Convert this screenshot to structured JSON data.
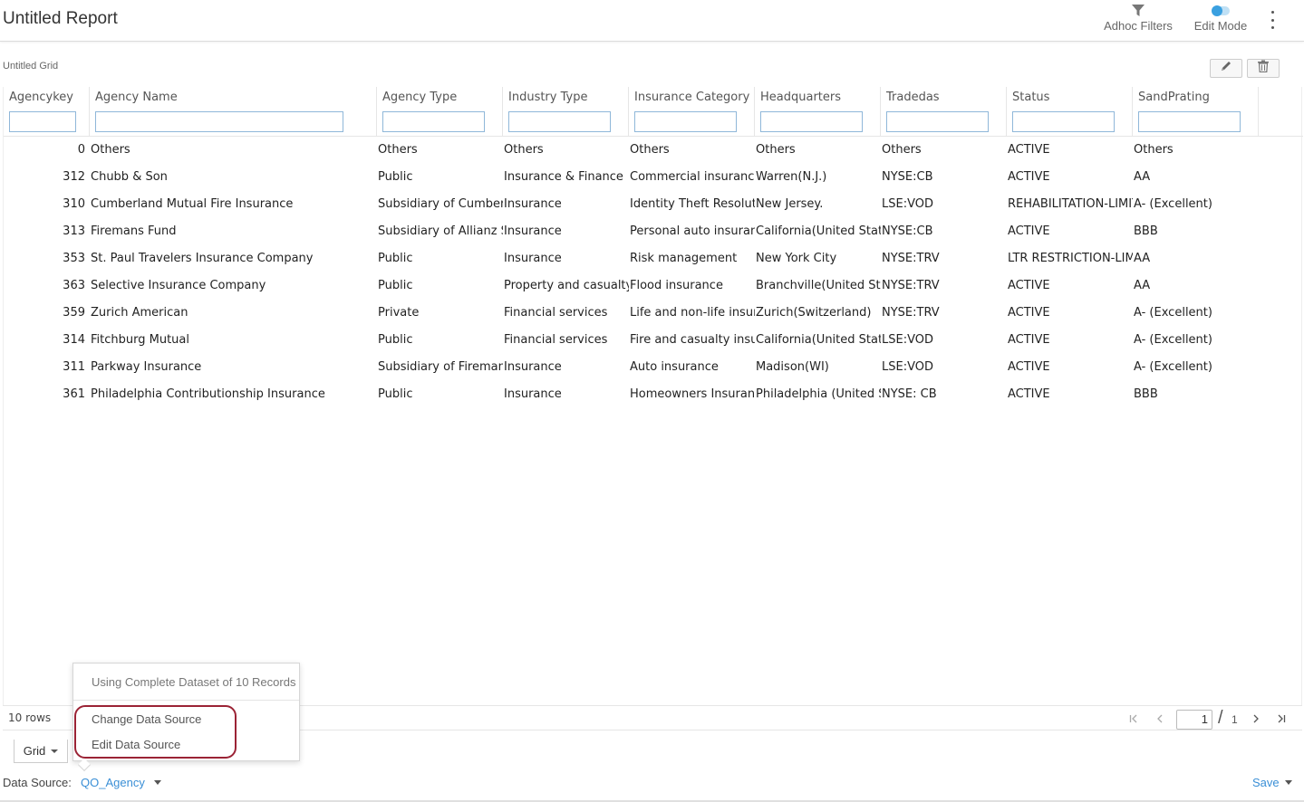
{
  "header": {
    "title": "Untitled Report",
    "adhoc_filters_label": "Adhoc Filters",
    "edit_mode_label": "Edit Mode"
  },
  "grid": {
    "title": "Untitled Grid",
    "columns": [
      {
        "label": "Agencykey"
      },
      {
        "label": "Agency Name"
      },
      {
        "label": "Agency Type"
      },
      {
        "label": "Industry Type"
      },
      {
        "label": "Insurance Category"
      },
      {
        "label": "Headquarters"
      },
      {
        "label": "Tradedas"
      },
      {
        "label": "Status"
      },
      {
        "label": "SandPrating"
      }
    ],
    "rows": [
      [
        "0",
        "Others",
        "Others",
        "Others",
        "Others",
        "Others",
        "Others",
        "ACTIVE",
        "Others"
      ],
      [
        "312",
        "Chubb & Son",
        "Public",
        "Insurance & Finance",
        "Commercial insurance",
        "Warren(N.J.)",
        "NYSE:CB",
        "ACTIVE",
        "AA"
      ],
      [
        "310",
        "Cumberland Mutual Fire Insurance",
        "Subsidiary of Cumberland",
        "Insurance",
        "Identity Theft Resolution",
        "New Jersey.",
        "LSE:VOD",
        "REHABILITATION-LIMITED",
        "A- (Excellent)"
      ],
      [
        "313",
        "Firemans Fund",
        "Subsidiary of Allianz SE",
        "Insurance",
        "Personal auto insurance",
        "California(United States)",
        "NYSE:CB",
        "ACTIVE",
        "BBB"
      ],
      [
        "353",
        "St. Paul Travelers Insurance Company",
        "Public",
        "Insurance",
        "Risk management",
        "New York City",
        "NYSE:TRV",
        "LTR RESTRICTION-LIMITED",
        "AA"
      ],
      [
        "363",
        "Selective Insurance Company",
        "Public",
        "Property and casualty",
        "Flood insurance",
        "Branchville(United States)",
        "NYSE:TRV",
        "ACTIVE",
        "AA"
      ],
      [
        "359",
        "Zurich American",
        "Private",
        "Financial services",
        "Life and non-life insurance",
        "Zurich(Switzerland)",
        "NYSE:TRV",
        "ACTIVE",
        "A- (Excellent)"
      ],
      [
        "314",
        "Fitchburg Mutual",
        "Public",
        "Financial services",
        "Fire and casualty insurance",
        "California(United States)",
        "LSE:VOD",
        "ACTIVE",
        "A- (Excellent)"
      ],
      [
        "311",
        "Parkway Insurance",
        "Subsidiary of Firemans Fund",
        "Insurance",
        "Auto insurance",
        "Madison(WI)",
        "LSE:VOD",
        "ACTIVE",
        "A- (Excellent)"
      ],
      [
        "361",
        "Philadelphia Contributionship Insurance",
        "Public",
        "Insurance",
        "Homeowners Insurance",
        "Philadelphia (United States)",
        "NYSE: CB",
        "ACTIVE",
        "BBB"
      ]
    ],
    "row_count": "10 rows",
    "current_page": "1",
    "page_separator": "/",
    "total_pages": "1"
  },
  "tabs": {
    "grid_label": "Grid"
  },
  "data_source": {
    "label": "Data Source:",
    "value": "QO_Agency"
  },
  "save_label": "Save",
  "menu": {
    "info": "Using Complete Dataset of 10 Records",
    "change_label": "Change Data Source",
    "edit_label": "Edit Data Source"
  },
  "colors": {
    "accent": "#3a8fd6",
    "highlight": "#9b2335",
    "filter_border": "#8fb7d9"
  }
}
